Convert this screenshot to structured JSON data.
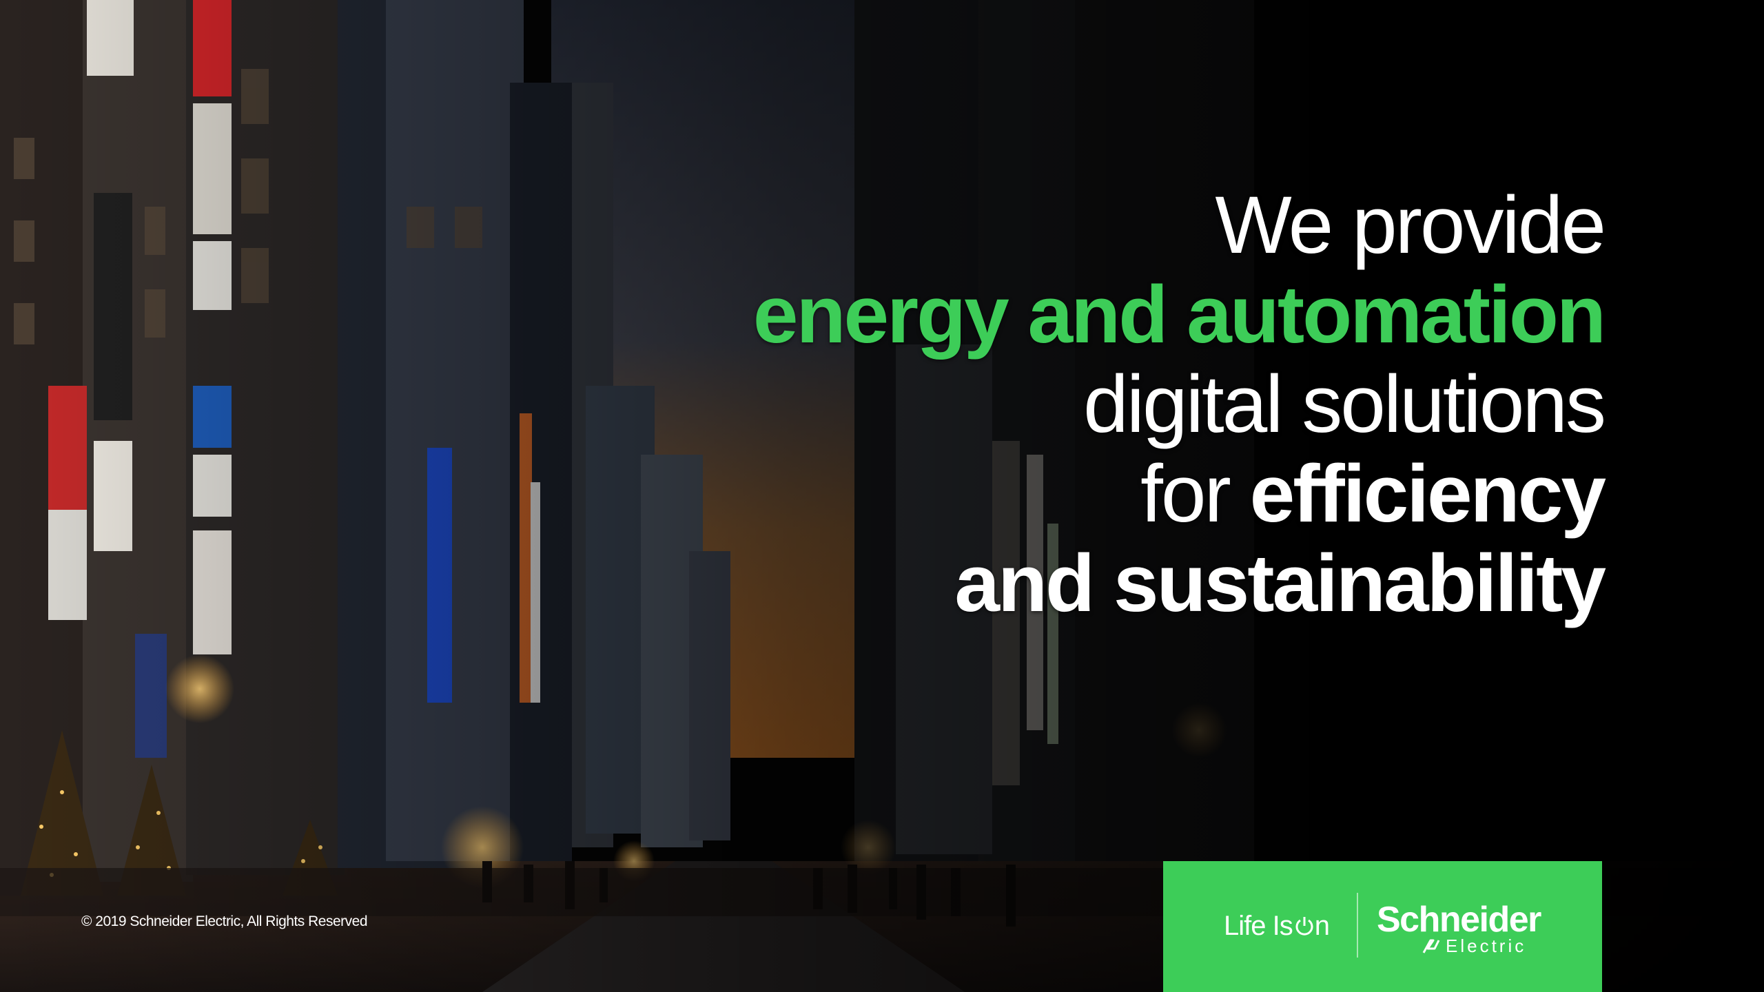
{
  "headline": {
    "line1": "We provide",
    "line2": "energy and automation",
    "line3": "digital solutions",
    "line4_plain": "for ",
    "line4_bold": "efficiency",
    "line5": "and sustainability"
  },
  "footer": {
    "copyright": "© 2019 Schneider Electric, All Rights Reserved"
  },
  "brand": {
    "tagline_before": "Life Is ",
    "tagline_after": "n",
    "power_icon": "power-on-icon",
    "company": "Schneider",
    "division": "Electric",
    "logo_icon": "schneider-electric-mark-icon"
  },
  "background": {
    "scene": "night-city-street-photo"
  },
  "colors": {
    "accent_green": "#3dcd58",
    "text": "#ffffff",
    "background": "#000000"
  }
}
